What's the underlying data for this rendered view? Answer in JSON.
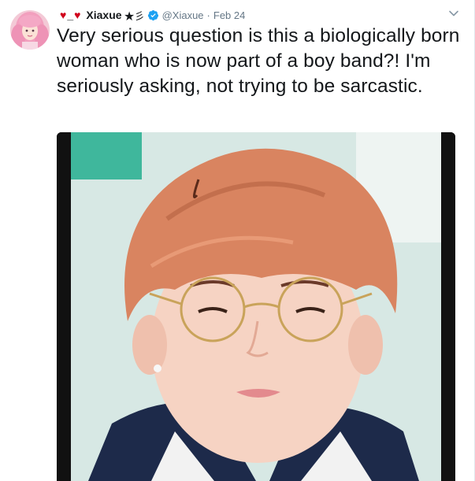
{
  "tweet": {
    "name_prefix_heart_left": "♥",
    "name_prefix_separator": "_",
    "name_prefix_heart_right": "♥",
    "display_name": "Xiaxue",
    "name_suffix": "★彡",
    "handle": "@Xiaxue",
    "separator": "·",
    "timestamp": "Feb 24",
    "text": "Very serious question is this a biologically born woman who is now part of a boy band?! I'm seriously asking, not trying to be sarcastic."
  },
  "icons": {
    "verified": "verified-badge-icon",
    "caret": "chevron-down-icon",
    "heart": "heart-icon"
  },
  "colors": {
    "heart": "#d0021b",
    "verified": "#1da1f2",
    "secondary_text": "#657786",
    "primary_text": "#14171a"
  }
}
